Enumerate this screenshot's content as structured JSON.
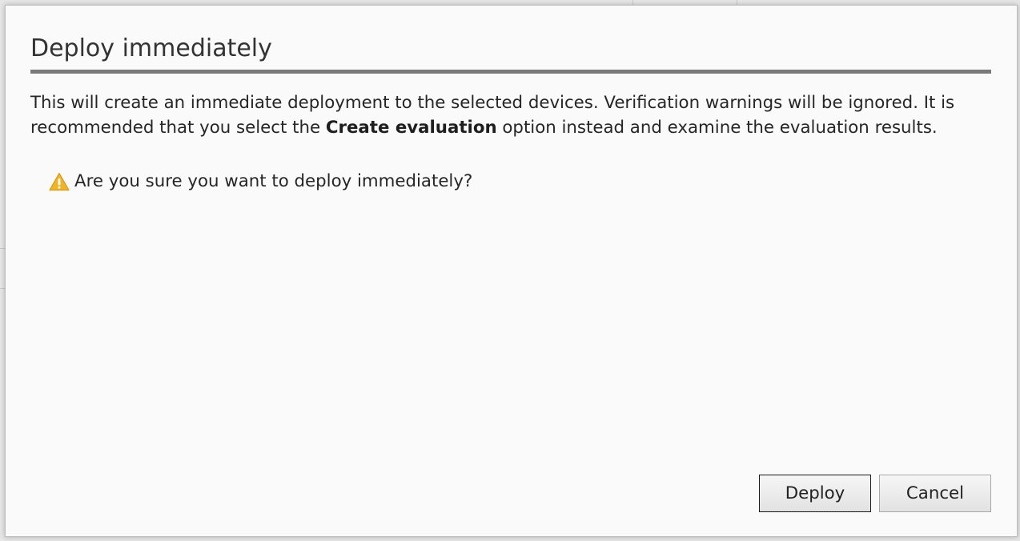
{
  "dialog": {
    "title": "Deploy immediately",
    "message_part1": "This will create an immediate deployment to the selected devices. Verification warnings will be ignored. It is recommended that you select the ",
    "message_bold": "Create evaluation",
    "message_part2": " option instead and examine the evaluation results.",
    "confirm_icon": "warning-icon",
    "confirm_text": "Are you sure you want to deploy immediately?",
    "buttons": {
      "deploy_label": "Deploy",
      "cancel_label": "Cancel"
    }
  },
  "colors": {
    "warning": "#f0b429",
    "title_rule": "#7a7a7a",
    "dialog_bg": "#fafafa"
  }
}
